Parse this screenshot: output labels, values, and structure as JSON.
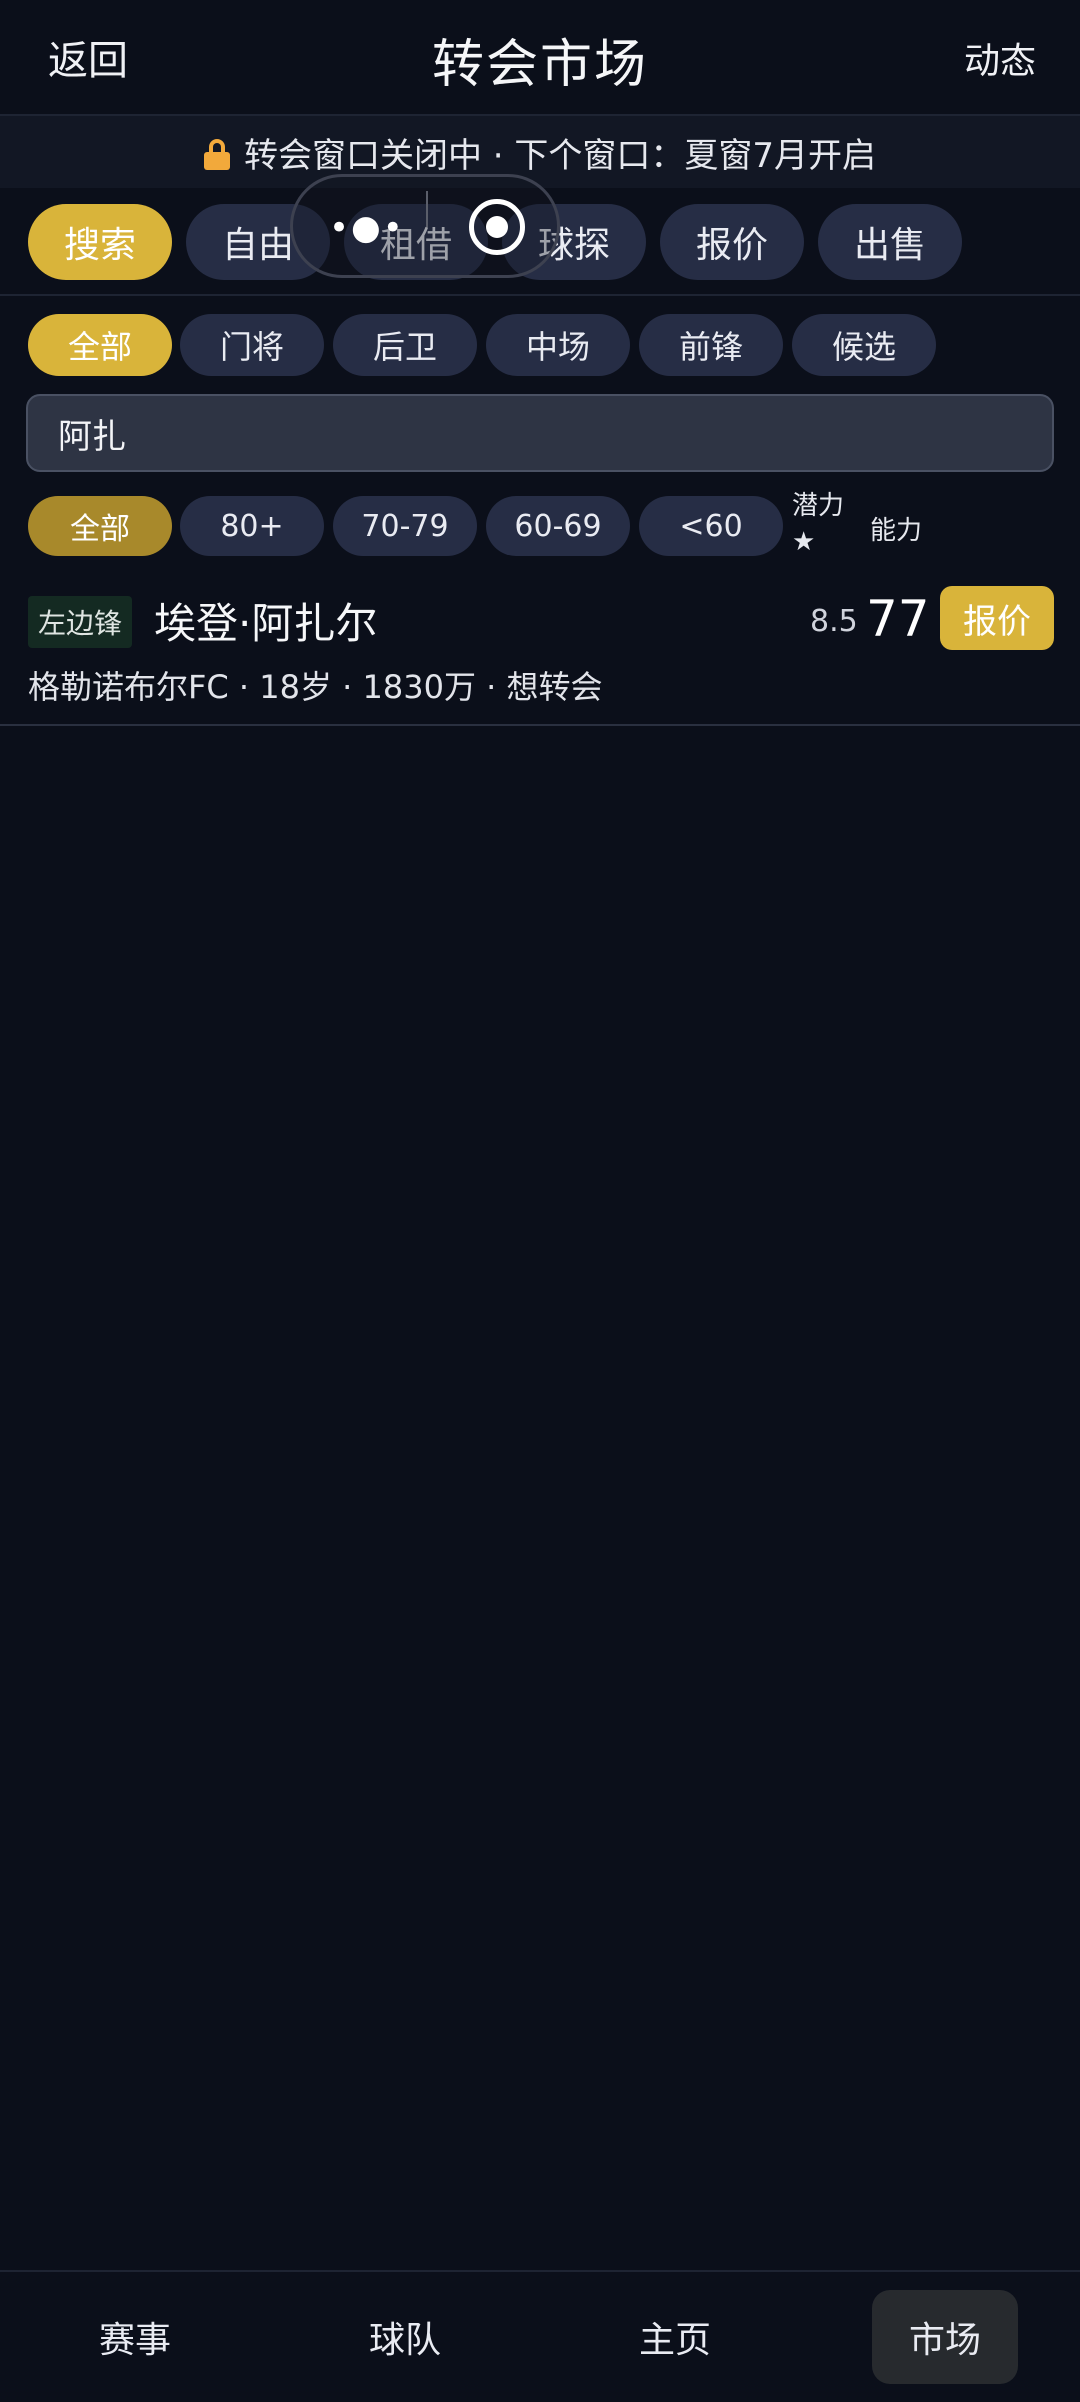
{
  "header": {
    "back_label": "返回",
    "title": "转会市场",
    "news_label": "动态"
  },
  "notice": {
    "icon": "lock-icon",
    "text": "转会窗口关闭中 · 下个窗口：夏窗7月开启"
  },
  "tabs": [
    {
      "label": "搜索",
      "active": true
    },
    {
      "label": "自由",
      "active": false
    },
    {
      "label": "租借",
      "active": false
    },
    {
      "label": "球探",
      "active": false
    },
    {
      "label": "报价",
      "active": false
    },
    {
      "label": "出售",
      "active": false
    }
  ],
  "positions": [
    {
      "label": "全部",
      "active": true
    },
    {
      "label": "门将"
    },
    {
      "label": "后卫"
    },
    {
      "label": "中场"
    },
    {
      "label": "前锋"
    },
    {
      "label": "候选"
    }
  ],
  "search": {
    "value": "阿扎"
  },
  "ratings": [
    {
      "label": "全部",
      "active": true
    },
    {
      "label": "80+"
    },
    {
      "label": "70-79"
    },
    {
      "label": "60-69"
    },
    {
      "label": "<60"
    }
  ],
  "sort": {
    "potential_label": "潜力★",
    "ability_label": "能力"
  },
  "players": [
    {
      "position": "左边锋",
      "name": "埃登·阿扎尔",
      "potential": "8.5",
      "overall": "77",
      "offer_label": "报价",
      "info": "格勒诺布尔FC · 18岁 · 1830万 · 想转会"
    }
  ],
  "bottom_nav": [
    {
      "label": "赛事"
    },
    {
      "label": "球队"
    },
    {
      "label": "主页"
    },
    {
      "label": "市场",
      "active": true
    }
  ],
  "colors": {
    "background": "#0b0f1a",
    "accent": "#d9b43a",
    "pill": "#262d45",
    "lock": "#f2a93b"
  }
}
